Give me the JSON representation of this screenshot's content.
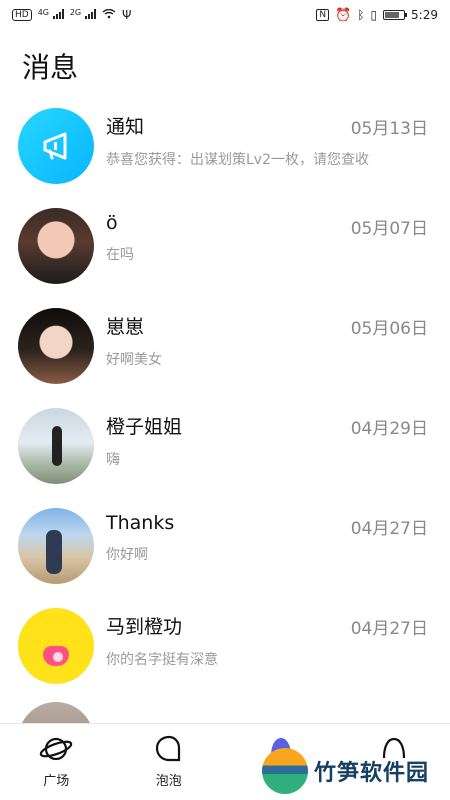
{
  "status_bar": {
    "left": [
      "HD",
      "4G",
      "2G"
    ],
    "time": "5:29"
  },
  "page": {
    "title": "消息"
  },
  "messages": [
    {
      "name": "通知",
      "date": "05月13日",
      "preview": "恭喜您获得：出谋划策Lv2一枚，请您查收",
      "avatar": "notice-icon"
    },
    {
      "name": "ö",
      "date": "05月07日",
      "preview": "在吗",
      "avatar": "user-photo"
    },
    {
      "name": "崽崽",
      "date": "05月06日",
      "preview": "好啊美女",
      "avatar": "user-photo"
    },
    {
      "name": "橙子姐姐",
      "date": "04月29日",
      "preview": "嗨",
      "avatar": "user-photo"
    },
    {
      "name": "Thanks",
      "date": "04月27日",
      "preview": "你好啊",
      "avatar": "user-photo"
    },
    {
      "name": "马到橙功",
      "date": "04月27日",
      "preview": "你的名字挺有深意",
      "avatar": "yellow-blob"
    }
  ],
  "tabs": [
    {
      "label": "广场",
      "icon": "planet-icon"
    },
    {
      "label": "泡泡",
      "icon": "bubble-icon"
    },
    {
      "label": "",
      "icon": "message-icon"
    },
    {
      "label": "",
      "icon": "profile-icon"
    }
  ],
  "watermark": {
    "text": "竹笋软件园"
  }
}
